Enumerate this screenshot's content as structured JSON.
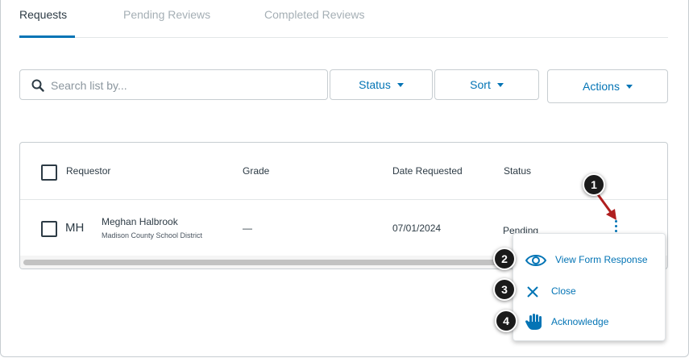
{
  "tabs": [
    {
      "label": "Requests",
      "active": true
    },
    {
      "label": "Pending Reviews",
      "active": false
    },
    {
      "label": "Completed Reviews",
      "active": false
    }
  ],
  "toolbar": {
    "search_placeholder": "Search list by...",
    "status_label": "Status",
    "sort_label": "Sort",
    "actions_label": "Actions"
  },
  "table": {
    "columns": [
      "Requestor",
      "Grade",
      "Date Requested",
      "Status"
    ],
    "rows": [
      {
        "initials": "MH",
        "name": "Meghan Halbrook",
        "organization": "Madison County School District",
        "grade": "—",
        "date_requested": "07/01/2024",
        "status": "Pending"
      }
    ]
  },
  "row_menu": {
    "items": [
      {
        "label": "View Form Response",
        "icon": "eye-icon"
      },
      {
        "label": "Close",
        "icon": "close-icon"
      },
      {
        "label": "Acknowledge",
        "icon": "hand-icon"
      }
    ]
  },
  "callouts": [
    "1",
    "2",
    "3",
    "4"
  ],
  "colors": {
    "accent": "#0374b5",
    "text": "#2d3b45",
    "muted": "#a5afb5",
    "border": "#c7cdd1",
    "callout_arrow": "#b01f1f"
  }
}
